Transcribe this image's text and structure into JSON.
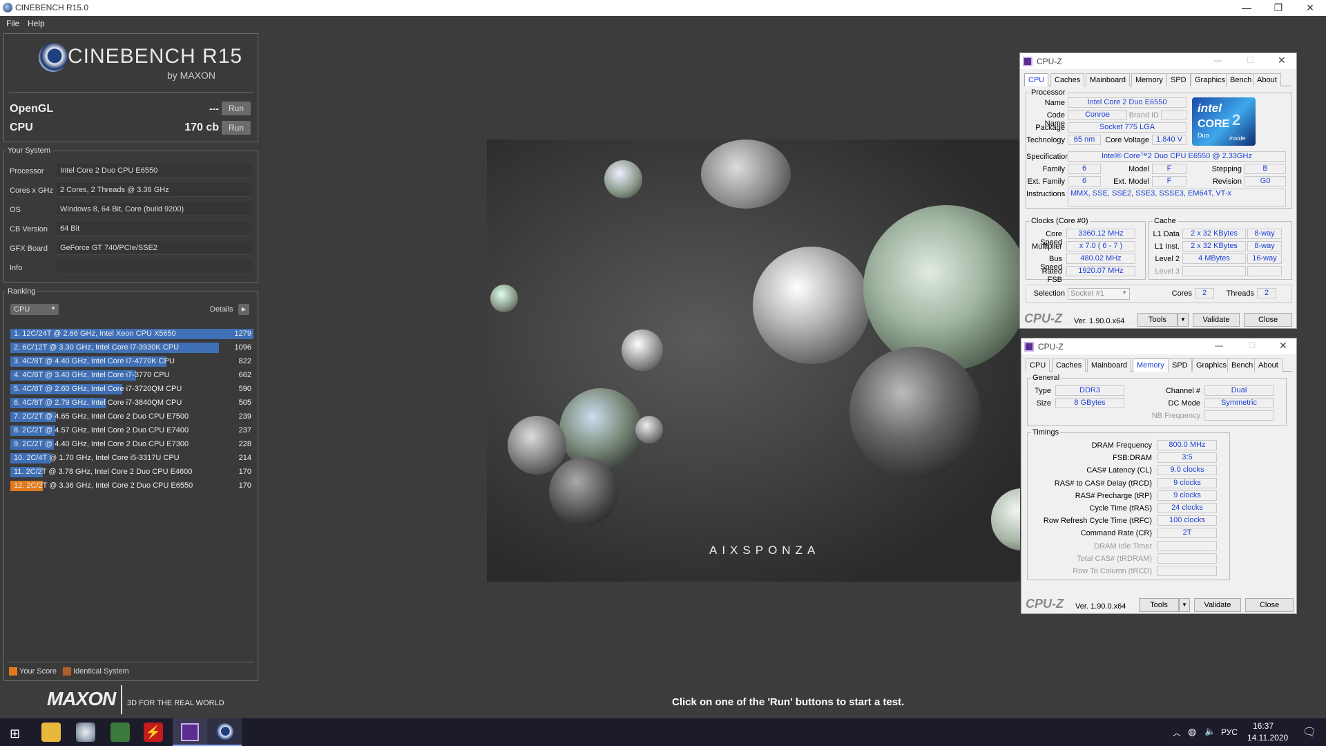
{
  "window": {
    "title": "CINEBENCH R15.0",
    "min": "—",
    "max": "❐",
    "close": "✕"
  },
  "menu": [
    "File",
    "Help"
  ],
  "logo": {
    "name": "CINEBENCH R15",
    "by": "by MAXON"
  },
  "tests": [
    {
      "label": "OpenGL",
      "score": "---",
      "run": "Run"
    },
    {
      "label": "CPU",
      "score": "170 cb",
      "run": "Run"
    }
  ],
  "your_system": {
    "title": "Your System",
    "rows": [
      {
        "k": "Processor",
        "v": "Intel Core 2 Duo CPU E6550"
      },
      {
        "k": "Cores x GHz",
        "v": "2 Cores, 2 Threads @ 3.36 GHz"
      },
      {
        "k": "OS",
        "v": "Windows 8, 64 Bit, Core (build 9200)"
      },
      {
        "k": "CB Version",
        "v": "64 Bit"
      },
      {
        "k": "GFX Board",
        "v": "GeForce GT 740/PCIe/SSE2"
      },
      {
        "k": "Info",
        "v": ""
      }
    ]
  },
  "ranking": {
    "title": "Ranking",
    "dropdown": "CPU",
    "details": "Details",
    "max": 1279,
    "rows": [
      {
        "label": "1. 12C/24T @ 2.66 GHz, Intel Xeon CPU X5650",
        "value": 1279,
        "color": "#3f6fb5"
      },
      {
        "label": "2. 6C/12T @ 3.30 GHz,  Intel Core i7-3930K CPU",
        "value": 1096,
        "color": "#3f6fb5"
      },
      {
        "label": "3. 4C/8T @ 4.40 GHz, Intel Core i7-4770K CPU",
        "value": 822,
        "color": "#3f6fb5"
      },
      {
        "label": "4. 4C/8T @ 3.40 GHz,  Intel Core i7-3770 CPU",
        "value": 662,
        "color": "#3f6fb5"
      },
      {
        "label": "5. 4C/8T @ 2.60 GHz, Intel Core i7-3720QM CPU",
        "value": 590,
        "color": "#3f6fb5"
      },
      {
        "label": "6. 4C/8T @ 2.79 GHz,  Intel Core i7-3840QM CPU",
        "value": 505,
        "color": "#3f6fb5"
      },
      {
        "label": "7. 2C/2T @ 4.65 GHz, Intel Core 2 Duo CPU E7500",
        "value": 239,
        "color": "#3f6fb5"
      },
      {
        "label": "8. 2C/2T @ 4.57 GHz, Intel Core 2 Duo CPU E7400",
        "value": 237,
        "color": "#3f6fb5"
      },
      {
        "label": "9. 2C/2T @ 4.40 GHz, Intel Core 2 Duo CPU E7300",
        "value": 228,
        "color": "#3f6fb5"
      },
      {
        "label": "10. 2C/4T @ 1.70 GHz,  Intel Core i5-3317U CPU",
        "value": 214,
        "color": "#3f6fb5"
      },
      {
        "label": "11. 2C/2T @ 3.78 GHz, Intel Core 2 Duo CPU E4600",
        "value": 170,
        "color": "#3f6fb5"
      },
      {
        "label": "12. 2C/2T @ 3.36 GHz, Intel Core 2 Duo CPU E6550",
        "value": 170,
        "color": "#e07a1c"
      }
    ],
    "legend": [
      {
        "label": "Your Score",
        "color": "#e07a1c"
      },
      {
        "label": "Identical System",
        "color": "#b0602a"
      }
    ]
  },
  "footer": {
    "brand": "MAXON",
    "tagline": "3D FOR THE REAL WORLD",
    "status": "Click on one of the 'Run' buttons to start a test."
  },
  "render": {
    "watermark": "AIXSPONZA"
  },
  "cpuz1": {
    "title": "CPU-Z",
    "tabs": [
      "CPU",
      "Caches",
      "Mainboard",
      "Memory",
      "SPD",
      "Graphics",
      "Bench",
      "About"
    ],
    "active_tab": "CPU",
    "processor": {
      "group": "Processor",
      "name_l": "Name",
      "name": "Intel Core 2 Duo E6550",
      "code_l": "Code Name",
      "code": "Conroe",
      "brand_l": "Brand ID",
      "pkg_l": "Package",
      "pkg": "Socket 775 LGA",
      "tech_l": "Technology",
      "tech": "65 nm",
      "volt_l": "Core Voltage",
      "volt": "1.840 V",
      "spec_l": "Specification",
      "spec": "Intel® Core™2 Duo CPU     E6550  @ 2.33GHz",
      "fam_l": "Family",
      "fam": "6",
      "model_l": "Model",
      "model": "F",
      "step_l": "Stepping",
      "step": "B",
      "efam_l": "Ext. Family",
      "efam": "6",
      "emodel_l": "Ext. Model",
      "emodel": "F",
      "rev_l": "Revision",
      "rev": "G0",
      "instr_l": "Instructions",
      "instr": "MMX, SSE, SSE2, SSE3, SSSE3, EM64T, VT-x",
      "badge1": "intel",
      "badge2": "CORE",
      "badge3": "2",
      "badge4": "Duo",
      "badge5": "inside"
    },
    "clocks": {
      "group": "Clocks (Core #0)",
      "cs_l": "Core Speed",
      "cs": "3360.12 MHz",
      "mul_l": "Multiplier",
      "mul": "x 7.0 ( 6 - 7 )",
      "bus_l": "Bus Speed",
      "bus": "480.02 MHz",
      "fsb_l": "Rated FSB",
      "fsb": "1920.07 MHz"
    },
    "cache": {
      "group": "Cache",
      "l1d_l": "L1 Data",
      "l1d": "2 x 32 KBytes",
      "l1d_w": "8-way",
      "l1i_l": "L1 Inst.",
      "l1i": "2 x 32 KBytes",
      "l1i_w": "8-way",
      "l2_l": "Level 2",
      "l2": "4 MBytes",
      "l2_w": "16-way",
      "l3_l": "Level 3"
    },
    "sel_l": "Selection",
    "sel": "Socket #1",
    "cores_l": "Cores",
    "cores": "2",
    "threads_l": "Threads",
    "threads": "2",
    "logo": "CPU-Z",
    "ver": "Ver. 1.90.0.x64",
    "tools": "Tools",
    "validate": "Validate",
    "close": "Close"
  },
  "cpuz2": {
    "title": "CPU-Z",
    "active_tab": "Memory",
    "general": {
      "group": "General",
      "type_l": "Type",
      "type": "DDR3",
      "size_l": "Size",
      "size": "8 GBytes",
      "ch_l": "Channel #",
      "ch": "Dual",
      "dc_l": "DC Mode",
      "dc": "Symmetric",
      "nb_l": "NB Frequency"
    },
    "timings": {
      "group": "Timings",
      "rows": [
        {
          "k": "DRAM Frequency",
          "v": "800.0 MHz",
          "dis": false
        },
        {
          "k": "FSB:DRAM",
          "v": "3:5",
          "dis": false
        },
        {
          "k": "CAS# Latency (CL)",
          "v": "9.0 clocks",
          "dis": false
        },
        {
          "k": "RAS# to CAS# Delay (tRCD)",
          "v": "9 clocks",
          "dis": false
        },
        {
          "k": "RAS# Precharge (tRP)",
          "v": "9 clocks",
          "dis": false
        },
        {
          "k": "Cycle Time (tRAS)",
          "v": "24 clocks",
          "dis": false
        },
        {
          "k": "Row Refresh Cycle Time (tRFC)",
          "v": "100 clocks",
          "dis": false
        },
        {
          "k": "Command Rate (CR)",
          "v": "2T",
          "dis": false
        },
        {
          "k": "DRAM Idle Timer",
          "v": "",
          "dis": true
        },
        {
          "k": "Total CAS# (tRDRAM)",
          "v": "",
          "dis": true
        },
        {
          "k": "Row To Column (tRCD)",
          "v": "",
          "dis": true
        }
      ]
    },
    "logo": "CPU-Z",
    "ver": "Ver. 1.90.0.x64",
    "tools": "Tools",
    "validate": "Validate",
    "close": "Close"
  },
  "taskbar": {
    "lang": "РУС",
    "time": "16:37",
    "date": "14.11.2020"
  }
}
